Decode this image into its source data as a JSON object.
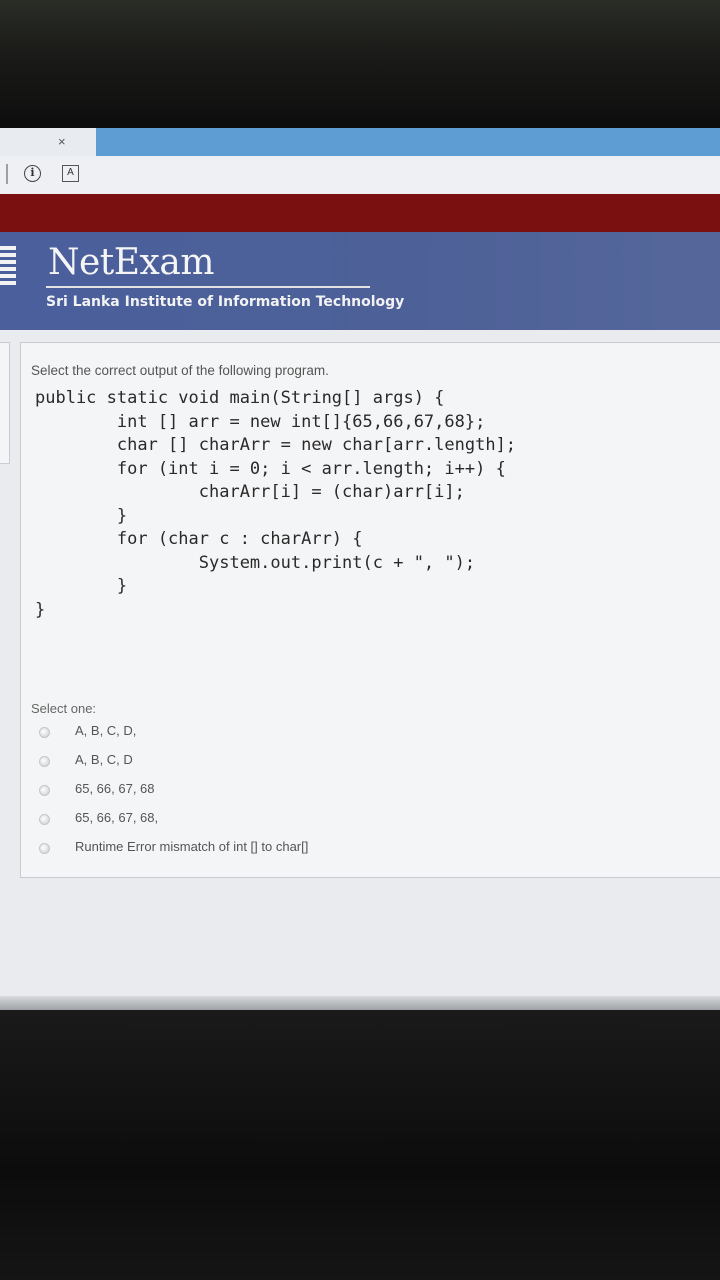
{
  "browser": {
    "tab_close": "×",
    "info_icon_glyph": "i",
    "ext_icon_glyph": "A"
  },
  "site": {
    "title": "NetExam",
    "subtitle": "Sri Lanka Institute of Information Technology",
    "colors": {
      "red_bar": "#7a1010",
      "header": "#4a5f9c"
    }
  },
  "question": {
    "prompt": "Select the correct output of the following program.",
    "code_lines": [
      "public static void main(String[] args) {",
      "        int [] arr = new int[]{65,66,67,68};",
      "        char [] charArr = new char[arr.length];",
      "        for (int i = 0; i < arr.length; i++) {",
      "                charArr[i] = (char)arr[i];",
      "        }",
      "        for (char c : charArr) {",
      "                System.out.print(c + \", \");",
      "        }",
      "}"
    ]
  },
  "answers": {
    "label": "Select one:",
    "options": [
      "A, B, C, D,",
      "A, B, C, D",
      "65, 66, 67, 68",
      "65, 66, 67, 68,",
      "Runtime Error mismatch of int [] to char[]"
    ]
  }
}
